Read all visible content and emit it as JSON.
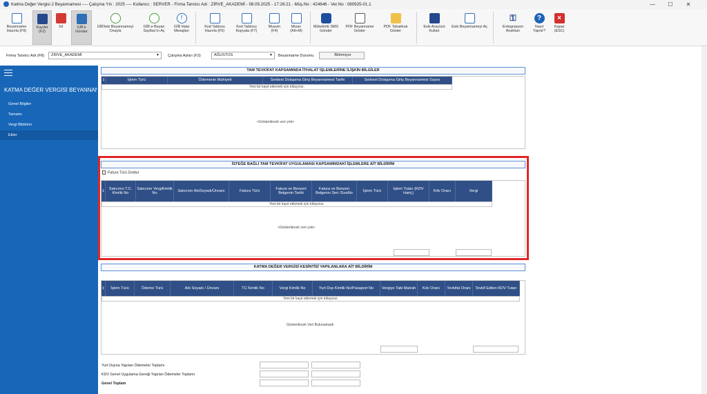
{
  "window": {
    "title": "Katma Değer Vergisi 2 Beyannamesi  ----  Çalışma Yılı : 2025  ----  Kullanıcı : SERVER - Firma Tanıtıcı Adı : ZIRVE_AKADEMİ - 08.09.2025 - 17:26:21 - Müş.No : 424646 - Ver.No : 080925-01.1",
    "min": "—",
    "max": "☐",
    "close": "✕"
  },
  "toolbar": {
    "beyanname_hazirla": "Beyanname Hazırla (F9)",
    "kaydet": "Kaydet (F2)",
    "sil": "Sil",
    "gibe_gonder": "GİB'e Gönder",
    "gibteki_onayla": "GİB'teki Beyannameyi Onayla",
    "gib_ebeyan": "GİB e-Beyan Sayfası'nı Aç",
    "gib_hata": "GİB Hata Mesajları",
    "kod_hazirla": "Kod Tablosu Hazırla (F5)",
    "kod_kopyala": "Kod Tablosu Kopyala (F7)",
    "muavin": "Muavin (F4)",
    "mizan": "Mizan (Alt+M)",
    "sms": "Mükellefe SMS Gönder",
    "pdf_goster": "PDF Beyanname Göster",
    "pdf_tahakkuk": "PDF Tahakkuk Göster",
    "eski_arayuz": "Eski Arayüzü Kullan",
    "eski_beyanname": "Eski Beyannameyi Aç",
    "entegrasyon": "Entegrasyon Anahtarı",
    "nasil": "Nasıl Yapılır?",
    "kapat": "Kapat (ESC)"
  },
  "form": {
    "firma_label": "Firma Tanıtıcı Adı (F8)",
    "firma_value": "ZIRVE_AKADEMİ",
    "calisma_label": "Çalışma Ayları (F3)",
    "calisma_value": "AĞUSTOS",
    "durum_label": "Beyanname Durumu",
    "durum_value": "Bilinmiyor"
  },
  "sidebar": {
    "title": "KATMA DEĞER VERGİSİ BEYANNAM...",
    "items": [
      "Genel Bilgiler",
      "Tamamı",
      "Vergi Bildirimi",
      "Ekler"
    ]
  },
  "section1": {
    "title": "TAM TEVKİFAT KAPSAMINDA İTHALAT İŞLEMLERİNE İLİŞKİN BİLGİLER",
    "cols": [
      "İşlem Türü",
      "Ödemenin Mahiyeti",
      "Serbest Dolaşıma Giriş Beyannamesi Tarihi",
      "Serbest Dolaşıma Giriş Beyannamesi Sayısı"
    ],
    "newrow": "Yeni bir kayıt eklemek için tıklayınız.",
    "empty": "<Gösterilecek veri yok>"
  },
  "section2": {
    "title": "İSTEĞE BAĞLI TAM TEVKİFAT UYGULAMASI KAPSAMINDAKİ İŞLEMLERE AİT BİLDİRİM",
    "fill_button": "Fatura Türü Doldur",
    "cols": [
      "Satıcının T.C. Kimlik No",
      "Satıcının VergiKimlik No",
      "Satıcının AdıSoyadı/Ünvanı",
      "Fatura Türü",
      "Fatura ve Benzeri Belgenin Tarihi",
      "Fatura ve Benzeri Belgenin Seri /SıraNo",
      "İşlem Türü",
      "İşlem Tutarı (KDV Hariç)",
      "Kdv Oranı",
      "Vergi"
    ],
    "newrow": "Yeni bir kayıt eklemek için tıklayınız.",
    "empty": "<Gösterilecek veri yok>"
  },
  "section3": {
    "title": "KATMA DEĞER VERGİSİ KESİNTİSİ YAPILANLARA AİT BİLDİRİM",
    "cols": [
      "İşlem Türü",
      "Ödeme Türü",
      "Adı Soyadı / Ünvanı",
      "TC Kimlik No",
      "Vergi Kimlik No",
      "Yurt Dışı Kimlik No/Pasaport No",
      "Vergiye Tabi Matrah",
      "Kdv Oranı",
      "Tevkifat Oranı",
      "Tevkif Edilen KDV Tutarı"
    ],
    "newrow": "Yeni bir kayıt eklemek için tıklayınız.",
    "empty": "Gösterilecek Veri Bulunamadı"
  },
  "totals": {
    "yurtdisi": "Yurt Dışına Yapılan Ödemeler Toplamı",
    "kdv_genel": "KDV Genel Uygulama Gereği Yapılan Ödemeler Toplamı",
    "genel": "Genel Toplam"
  }
}
